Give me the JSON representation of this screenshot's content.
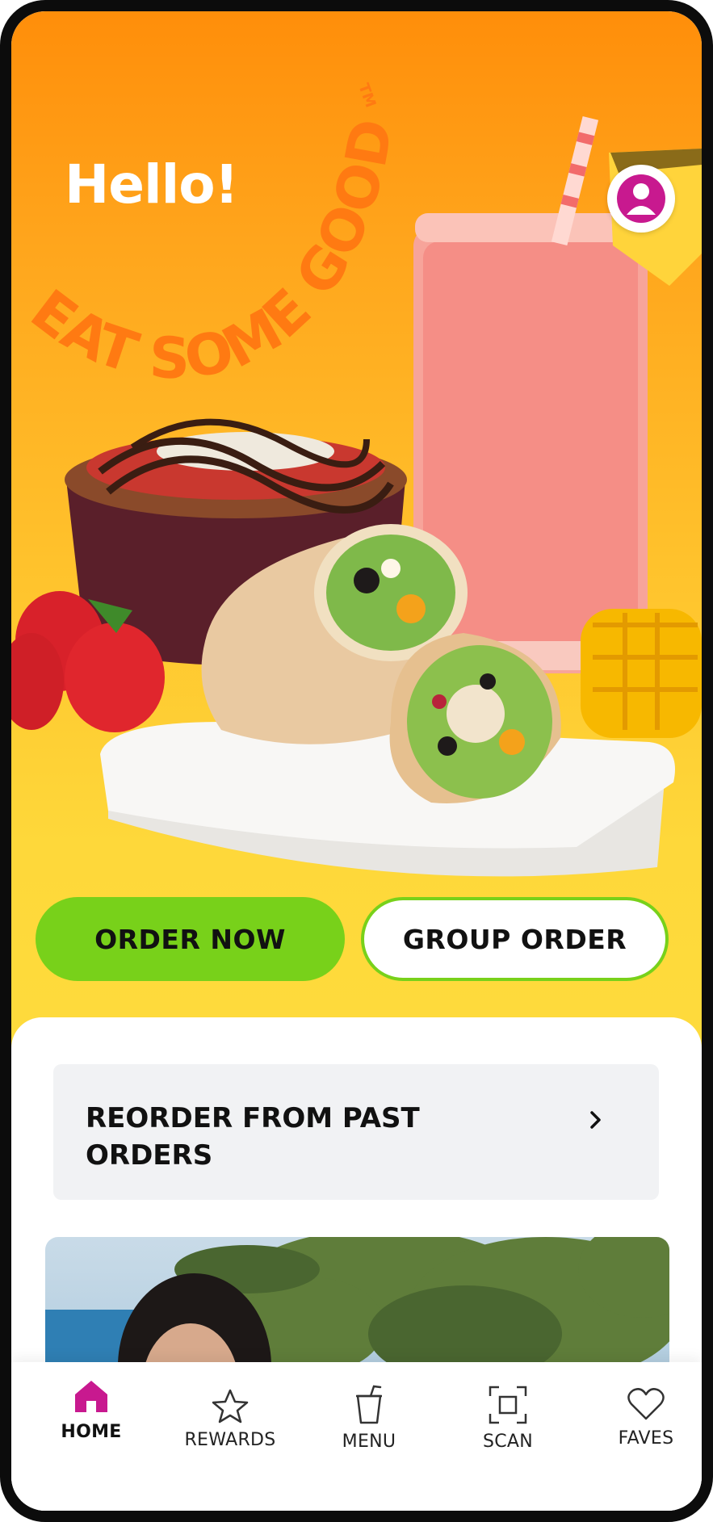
{
  "header": {
    "greeting": "Hello!",
    "slogan": "EAT SOME GOOD!",
    "slogan_mark": "TM"
  },
  "actions": {
    "order_now": "ORDER NOW",
    "group_order": "GROUP ORDER"
  },
  "reorder": {
    "label": "REORDER FROM PAST ORDERS"
  },
  "bottom_nav": [
    {
      "label": "HOME",
      "icon": "home-icon",
      "active": true
    },
    {
      "label": "REWARDS",
      "icon": "star-icon",
      "active": false
    },
    {
      "label": "MENU",
      "icon": "cup-icon",
      "active": false
    },
    {
      "label": "SCAN",
      "icon": "scan-icon",
      "active": false
    },
    {
      "label": "FAVES",
      "icon": "heart-icon",
      "active": false
    }
  ],
  "colors": {
    "accent_green": "#78d11a",
    "brand_magenta": "#c8198f",
    "hero_orange": "#ff8e0a",
    "hero_yellow": "#fedb3c"
  }
}
